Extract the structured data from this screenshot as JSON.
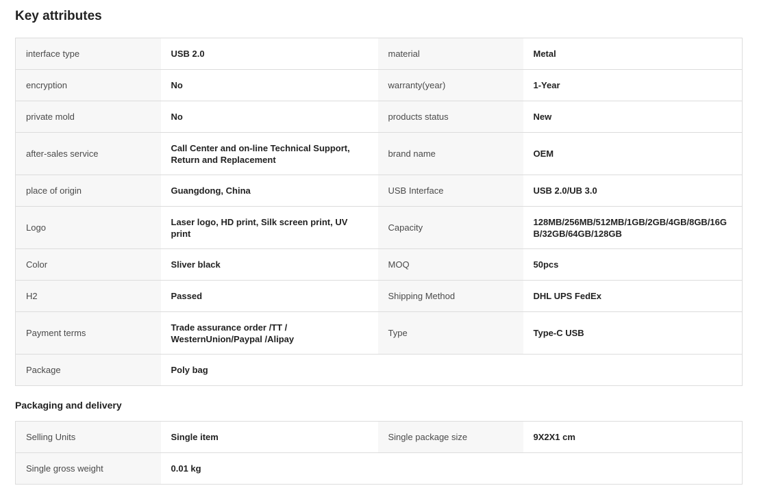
{
  "key_attributes": {
    "title": "Key attributes",
    "rows": [
      {
        "k1": "interface type",
        "v1": "USB 2.0",
        "k2": "material",
        "v2": "Metal"
      },
      {
        "k1": "encryption",
        "v1": "No",
        "k2": "warranty(year)",
        "v2": "1-Year"
      },
      {
        "k1": "private mold",
        "v1": "No",
        "k2": "products status",
        "v2": "New"
      },
      {
        "k1": "after-sales service",
        "v1": "Call Center and on-line Technical Support, Return and Replacement",
        "k2": "brand name",
        "v2": "OEM"
      },
      {
        "k1": "place of origin",
        "v1": "Guangdong, China",
        "k2": "USB Interface",
        "v2": "USB 2.0/UB 3.0"
      },
      {
        "k1": "Logo",
        "v1": "Laser logo, HD print, Silk screen print, UV print",
        "k2": "Capacity",
        "v2": "128MB/256MB/512MB/1GB/2GB/4GB/8GB/16GB/32GB/64GB/128GB"
      },
      {
        "k1": "Color",
        "v1": "Sliver black",
        "k2": "MOQ",
        "v2": "50pcs"
      },
      {
        "k1": "H2",
        "v1": "Passed",
        "k2": "Shipping Method",
        "v2": "DHL UPS FedEx"
      },
      {
        "k1": "Payment terms",
        "v1": "Trade assurance order /TT / WesternUnion/Paypal /Alipay",
        "k2": "Type",
        "v2": "Type-C USB"
      },
      {
        "k1": "Package",
        "v1": "Poly bag",
        "k2": "",
        "v2": ""
      }
    ]
  },
  "packaging": {
    "title": "Packaging and delivery",
    "rows": [
      {
        "k1": "Selling Units",
        "v1": "Single item",
        "k2": "Single package size",
        "v2": "9X2X1 cm"
      },
      {
        "k1": "Single gross weight",
        "v1": "0.01 kg",
        "k2": "",
        "v2": ""
      }
    ]
  },
  "colors": {
    "key_cell_bg": "#f7f7f7",
    "border": "#dcdcdc",
    "text": "#222222"
  }
}
